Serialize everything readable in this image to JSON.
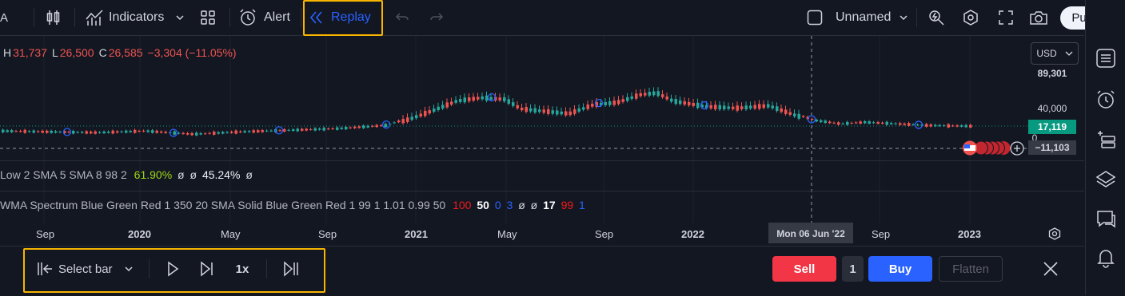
{
  "topbar": {
    "partial_symbol": "A",
    "indicators_label": "Indicators",
    "alert_label": "Alert",
    "replay_label": "Replay",
    "layout_name": "Unnamed",
    "publish_label": "Publish"
  },
  "legend": {
    "h_label": "H",
    "h_value": "31,737",
    "l_label": "L",
    "l_value": "26,500",
    "c_label": "C",
    "c_value": "26,585",
    "change": "−3,304 (−11.05%)"
  },
  "indicator1": {
    "text": "Low 2 SMA 5 SMA 8 98 2",
    "v1": "61.90%",
    "v2": "ø",
    "v3": "ø",
    "v4": "45.24%",
    "v5": "ø"
  },
  "indicator2": {
    "text": "WMA Spectrum Blue Green Red 1 350 20 SMA Solid Blue Green Red 1 99 1 1.01 0.99 50",
    "v1": "100",
    "v2": "50",
    "v3": "0",
    "v4": "3",
    "v5": "ø",
    "v6": "ø",
    "v7": "17",
    "v8": "99",
    "v9": "1"
  },
  "price_axis": {
    "currency": "USD",
    "p1": "89,301",
    "p2": "40,000",
    "p3": "17,119",
    "p4": "0",
    "p5": "−11,103"
  },
  "time_axis": {
    "labels": [
      "Sep",
      "2020",
      "May",
      "Sep",
      "2021",
      "May",
      "Sep",
      "2022",
      "Sep",
      "2023"
    ],
    "crosshair": "Mon 06 Jun '22"
  },
  "replay_bar": {
    "select_bar": "Select bar",
    "speed": "1x"
  },
  "trade": {
    "sell": "Sell",
    "qty": "1",
    "buy": "Buy",
    "flatten": "Flatten"
  },
  "colors": {
    "up": "#26a69a",
    "down": "#ef5350",
    "accent": "#2962ff",
    "highlight": "#f7b500"
  }
}
